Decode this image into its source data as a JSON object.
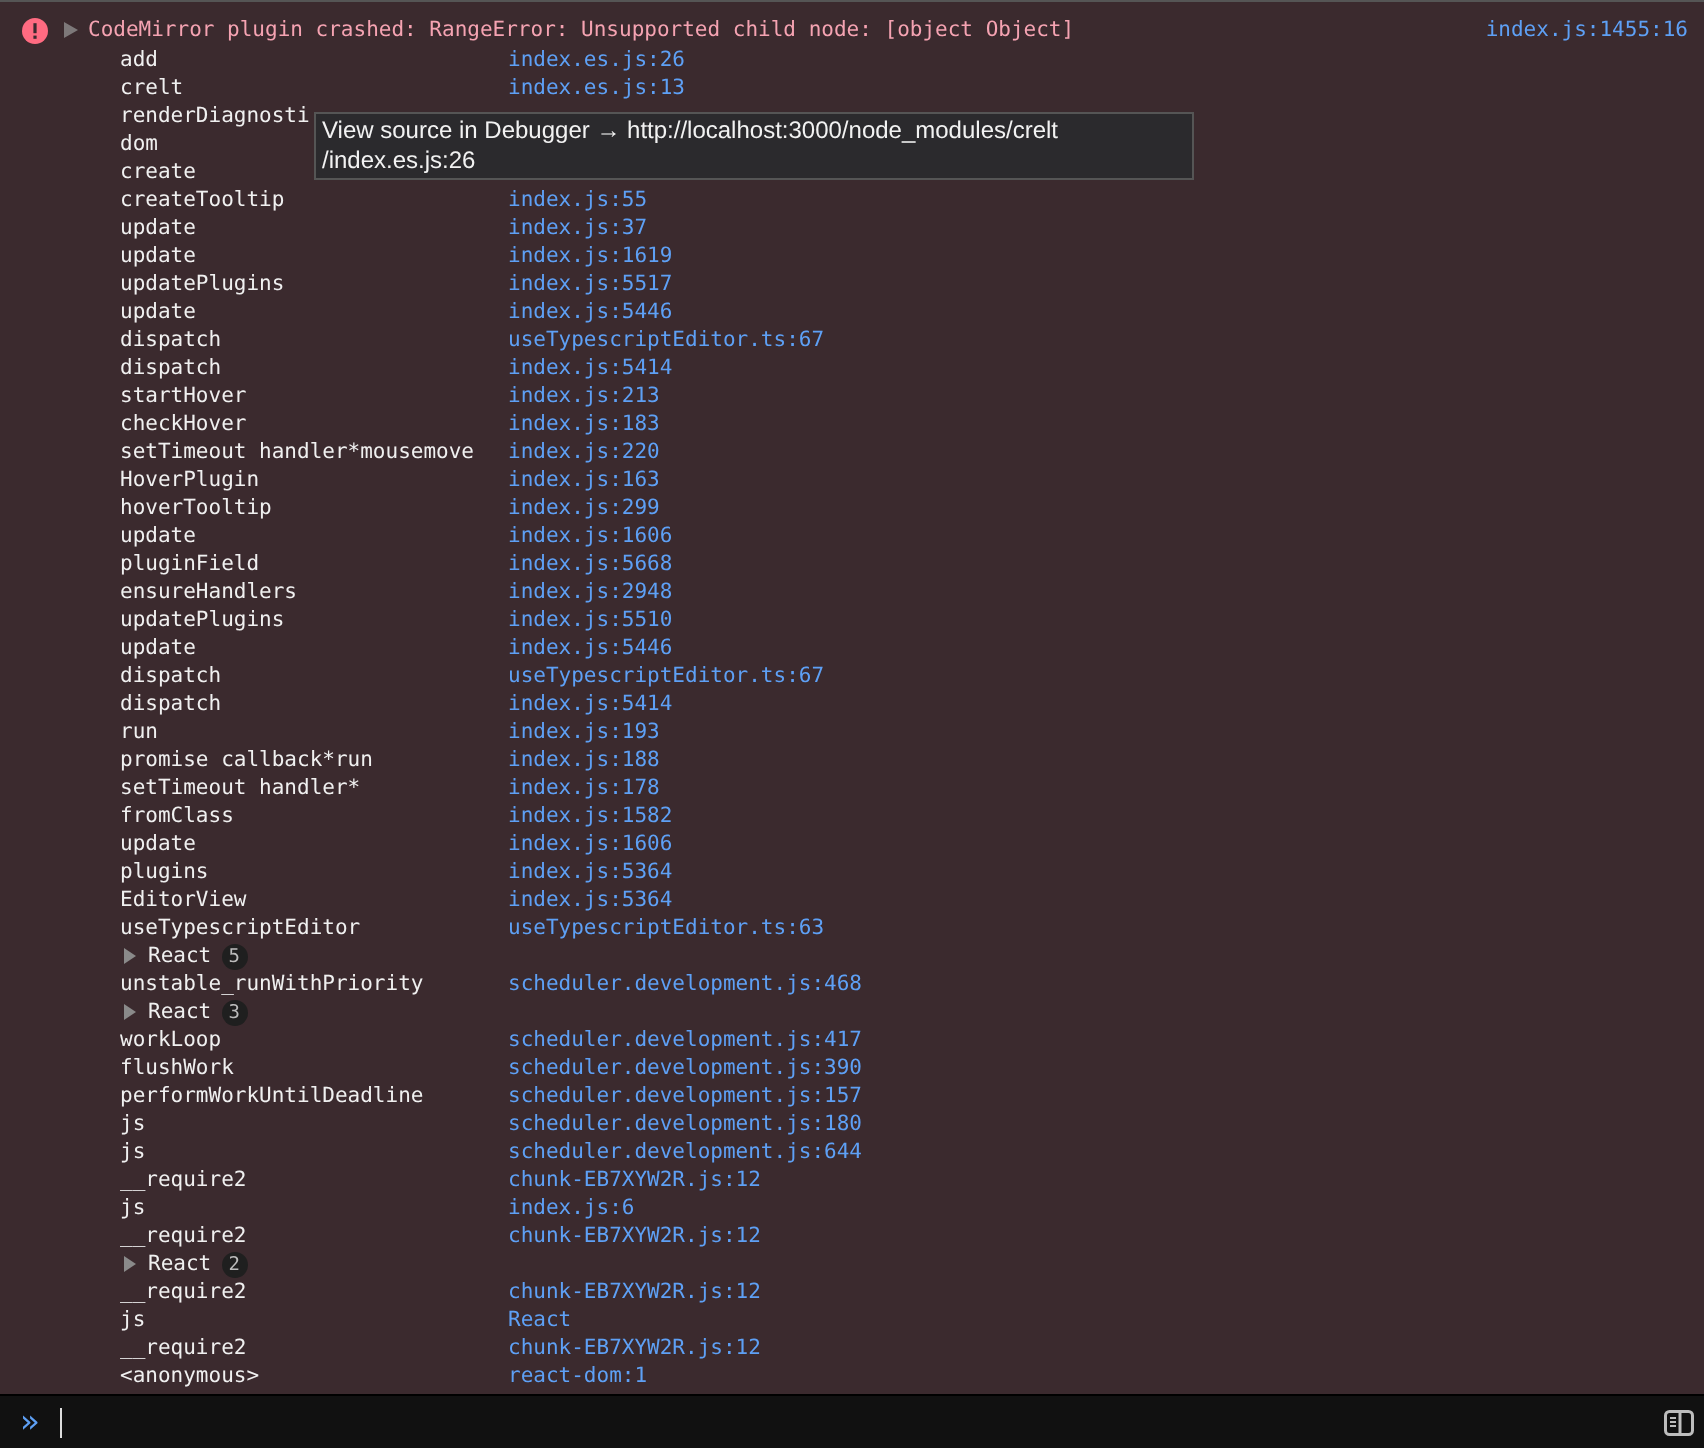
{
  "error": {
    "message": "CodeMirror plugin crashed: RangeError: Unsupported child node: [object Object]",
    "source": "index.js:1455:16",
    "expanded": true
  },
  "stack": [
    {
      "kind": "frame",
      "name": "add",
      "source": "index.es.js:26"
    },
    {
      "kind": "frame",
      "name": "crelt",
      "source": "index.es.js:13"
    },
    {
      "kind": "frame",
      "name": "renderDiagnosti"
    },
    {
      "kind": "frame",
      "name": "dom"
    },
    {
      "kind": "frame",
      "name": "create"
    },
    {
      "kind": "frame",
      "name": "createTooltip",
      "source": "index.js:55"
    },
    {
      "kind": "frame",
      "name": "update",
      "source": "index.js:37"
    },
    {
      "kind": "frame",
      "name": "update",
      "source": "index.js:1619"
    },
    {
      "kind": "frame",
      "name": "updatePlugins",
      "source": "index.js:5517"
    },
    {
      "kind": "frame",
      "name": "update",
      "source": "index.js:5446"
    },
    {
      "kind": "frame",
      "name": "dispatch",
      "source": "useTypescriptEditor.ts:67"
    },
    {
      "kind": "frame",
      "name": "dispatch",
      "source": "index.js:5414"
    },
    {
      "kind": "frame",
      "name": "startHover",
      "source": "index.js:213"
    },
    {
      "kind": "frame",
      "name": "checkHover",
      "source": "index.js:183"
    },
    {
      "kind": "frame",
      "name": "setTimeout handler*mousemove",
      "source": "index.js:220"
    },
    {
      "kind": "frame",
      "name": "HoverPlugin",
      "source": "index.js:163"
    },
    {
      "kind": "frame",
      "name": "hoverTooltip",
      "source": "index.js:299"
    },
    {
      "kind": "frame",
      "name": "update",
      "source": "index.js:1606"
    },
    {
      "kind": "frame",
      "name": "pluginField",
      "source": "index.js:5668"
    },
    {
      "kind": "frame",
      "name": "ensureHandlers",
      "source": "index.js:2948"
    },
    {
      "kind": "frame",
      "name": "updatePlugins",
      "source": "index.js:5510"
    },
    {
      "kind": "frame",
      "name": "update",
      "source": "index.js:5446"
    },
    {
      "kind": "frame",
      "name": "dispatch",
      "source": "useTypescriptEditor.ts:67"
    },
    {
      "kind": "frame",
      "name": "dispatch",
      "source": "index.js:5414"
    },
    {
      "kind": "frame",
      "name": "run",
      "source": "index.js:193"
    },
    {
      "kind": "frame",
      "name": "promise callback*run",
      "source": "index.js:188"
    },
    {
      "kind": "frame",
      "name": "setTimeout handler*",
      "source": "index.js:178"
    },
    {
      "kind": "frame",
      "name": "fromClass",
      "source": "index.js:1582"
    },
    {
      "kind": "frame",
      "name": "update",
      "source": "index.js:1606"
    },
    {
      "kind": "frame",
      "name": "plugins",
      "source": "index.js:5364"
    },
    {
      "kind": "frame",
      "name": "EditorView",
      "source": "index.js:5364"
    },
    {
      "kind": "frame",
      "name": "useTypescriptEditor",
      "source": "useTypescriptEditor.ts:63"
    },
    {
      "kind": "group",
      "name": "React",
      "count": "5",
      "expanded": false
    },
    {
      "kind": "frame",
      "name": "unstable_runWithPriority",
      "source": "scheduler.development.js:468"
    },
    {
      "kind": "group",
      "name": "React",
      "count": "3",
      "expanded": false
    },
    {
      "kind": "frame",
      "name": "workLoop",
      "source": "scheduler.development.js:417"
    },
    {
      "kind": "frame",
      "name": "flushWork",
      "source": "scheduler.development.js:390"
    },
    {
      "kind": "frame",
      "name": "performWorkUntilDeadline",
      "source": "scheduler.development.js:157"
    },
    {
      "kind": "frame",
      "name": "js",
      "source": "scheduler.development.js:180"
    },
    {
      "kind": "frame",
      "name": "js",
      "source": "scheduler.development.js:644"
    },
    {
      "kind": "frame",
      "name": "__require2",
      "source": "chunk-EB7XYW2R.js:12"
    },
    {
      "kind": "frame",
      "name": "js",
      "source": "index.js:6"
    },
    {
      "kind": "frame",
      "name": "__require2",
      "source": "chunk-EB7XYW2R.js:12"
    },
    {
      "kind": "group",
      "name": "React",
      "count": "2",
      "expanded": false
    },
    {
      "kind": "frame",
      "name": "__require2",
      "source": "chunk-EB7XYW2R.js:12"
    },
    {
      "kind": "frame",
      "name": "js",
      "source": "React"
    },
    {
      "kind": "frame",
      "name": "__require2",
      "source": "chunk-EB7XYW2R.js:12"
    },
    {
      "kind": "frame",
      "name": "<anonymous>",
      "source": "react-dom:1"
    }
  ],
  "tooltip": {
    "lines": [
      "View source in Debugger → http://localhost:3000/node_modules/crelt",
      "/index.es.js:26"
    ]
  },
  "console_input": {
    "prompt": "»"
  }
}
